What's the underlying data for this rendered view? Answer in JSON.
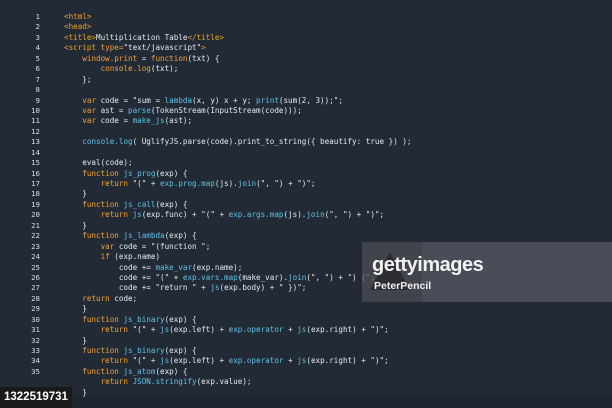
{
  "editor": {
    "line_numbers": [
      "1",
      "2",
      "3",
      "4",
      "5",
      "6",
      "7",
      "8",
      "9",
      "10",
      "11",
      "12",
      "13",
      "14",
      "15",
      "16",
      "17",
      "18",
      "19",
      "20",
      "21",
      "22",
      "23",
      "24",
      "25",
      "26",
      "27",
      "28",
      "29",
      "30",
      "31",
      "32",
      "33",
      "34",
      "35"
    ],
    "lines": [
      [
        {
          "t": "tag",
          "v": "<html>"
        }
      ],
      [
        {
          "t": "tag",
          "v": "<head>"
        }
      ],
      [
        {
          "t": "tag",
          "v": "<title>"
        },
        {
          "t": "plain",
          "v": "Multiplication Table"
        },
        {
          "t": "tag",
          "v": "</title>"
        }
      ],
      [
        {
          "t": "tag",
          "v": "<script "
        },
        {
          "t": "kw",
          "v": "type="
        },
        {
          "t": "plain",
          "v": "\"text/javascript\""
        },
        {
          "t": "tag",
          "v": ">"
        }
      ],
      [
        {
          "t": "plain",
          "v": "    "
        },
        {
          "t": "kw",
          "v": "window.print"
        },
        {
          "t": "plain",
          "v": " = "
        },
        {
          "t": "kw",
          "v": "function"
        },
        {
          "t": "plain",
          "v": "(txt) {"
        }
      ],
      [
        {
          "t": "plain",
          "v": "        "
        },
        {
          "t": "kw",
          "v": "console.log"
        },
        {
          "t": "plain",
          "v": "(txt);"
        }
      ],
      [
        {
          "t": "plain",
          "v": "    };"
        }
      ],
      [
        {
          "t": "plain",
          "v": ""
        }
      ],
      [
        {
          "t": "plain",
          "v": "    "
        },
        {
          "t": "kw",
          "v": "var"
        },
        {
          "t": "plain",
          "v": " code = \"sum = "
        },
        {
          "t": "fn",
          "v": "lambda"
        },
        {
          "t": "plain",
          "v": "(x, y) x + y; "
        },
        {
          "t": "fn",
          "v": "print"
        },
        {
          "t": "plain",
          "v": "(sum(2, 3));\";"
        }
      ],
      [
        {
          "t": "plain",
          "v": "    "
        },
        {
          "t": "kw",
          "v": "var"
        },
        {
          "t": "plain",
          "v": " ast = "
        },
        {
          "t": "fn",
          "v": "parse"
        },
        {
          "t": "plain",
          "v": "(TokenStream(InputStream(code)));"
        }
      ],
      [
        {
          "t": "plain",
          "v": "    "
        },
        {
          "t": "kw",
          "v": "var"
        },
        {
          "t": "plain",
          "v": " code = "
        },
        {
          "t": "fn",
          "v": "make_js"
        },
        {
          "t": "plain",
          "v": "(ast);"
        }
      ],
      [
        {
          "t": "plain",
          "v": ""
        }
      ],
      [
        {
          "t": "plain",
          "v": "    "
        },
        {
          "t": "fn",
          "v": "console.log"
        },
        {
          "t": "plain",
          "v": "( UglifyJS.parse(code).print_to_string({ beautify: true }) );"
        }
      ],
      [
        {
          "t": "plain",
          "v": ""
        }
      ],
      [
        {
          "t": "plain",
          "v": "    eval(code);"
        }
      ],
      [
        {
          "t": "plain",
          "v": "    "
        },
        {
          "t": "kw",
          "v": "function"
        },
        {
          "t": "plain",
          "v": " "
        },
        {
          "t": "fn",
          "v": "js_prog"
        },
        {
          "t": "plain",
          "v": "(exp) {"
        }
      ],
      [
        {
          "t": "plain",
          "v": "        "
        },
        {
          "t": "kw",
          "v": "return"
        },
        {
          "t": "plain",
          "v": " \"(\" + "
        },
        {
          "t": "fn",
          "v": "exp.prog.map"
        },
        {
          "t": "plain",
          "v": "(js)."
        },
        {
          "t": "fn",
          "v": "join"
        },
        {
          "t": "plain",
          "v": "(\", \") + \")\";"
        }
      ],
      [
        {
          "t": "plain",
          "v": "    }"
        }
      ],
      [
        {
          "t": "plain",
          "v": "    "
        },
        {
          "t": "kw",
          "v": "function"
        },
        {
          "t": "plain",
          "v": " "
        },
        {
          "t": "fn",
          "v": "js_call"
        },
        {
          "t": "plain",
          "v": "(exp) {"
        }
      ],
      [
        {
          "t": "plain",
          "v": "        "
        },
        {
          "t": "kw",
          "v": "return"
        },
        {
          "t": "plain",
          "v": " "
        },
        {
          "t": "fn",
          "v": "js"
        },
        {
          "t": "plain",
          "v": "(exp.func) + \"(\" + "
        },
        {
          "t": "fn",
          "v": "exp.args.map"
        },
        {
          "t": "plain",
          "v": "(js)."
        },
        {
          "t": "fn",
          "v": "join"
        },
        {
          "t": "plain",
          "v": "(\", \") + \")\";"
        }
      ],
      [
        {
          "t": "plain",
          "v": "    }"
        }
      ],
      [
        {
          "t": "plain",
          "v": "    "
        },
        {
          "t": "kw",
          "v": "function"
        },
        {
          "t": "plain",
          "v": " "
        },
        {
          "t": "fn",
          "v": "js_lambda"
        },
        {
          "t": "plain",
          "v": "(exp) {"
        }
      ],
      [
        {
          "t": "plain",
          "v": "        "
        },
        {
          "t": "kw",
          "v": "var"
        },
        {
          "t": "plain",
          "v": " code = \"(function \";"
        }
      ],
      [
        {
          "t": "plain",
          "v": "        "
        },
        {
          "t": "kw",
          "v": "if"
        },
        {
          "t": "plain",
          "v": " (exp.name)"
        }
      ],
      [
        {
          "t": "plain",
          "v": "            code += "
        },
        {
          "t": "fn",
          "v": "make_var"
        },
        {
          "t": "plain",
          "v": "(exp.name);"
        }
      ],
      [
        {
          "t": "plain",
          "v": "            code += \"(\" + "
        },
        {
          "t": "fn",
          "v": "exp.vars.map"
        },
        {
          "t": "plain",
          "v": "(make_var)."
        },
        {
          "t": "fn",
          "v": "join"
        },
        {
          "t": "plain",
          "v": "(\", \") + \") {\";"
        }
      ],
      [
        {
          "t": "plain",
          "v": "            code += \"return \" + "
        },
        {
          "t": "fn",
          "v": "js"
        },
        {
          "t": "plain",
          "v": "(exp.body) + \" })\";"
        }
      ],
      [
        {
          "t": "plain",
          "v": "    "
        },
        {
          "t": "kw",
          "v": "return"
        },
        {
          "t": "plain",
          "v": " code;"
        }
      ],
      [
        {
          "t": "plain",
          "v": "    }"
        }
      ],
      [
        {
          "t": "plain",
          "v": "    "
        },
        {
          "t": "kw",
          "v": "function"
        },
        {
          "t": "plain",
          "v": " "
        },
        {
          "t": "fn",
          "v": "js_binary"
        },
        {
          "t": "plain",
          "v": "(exp) {"
        }
      ],
      [
        {
          "t": "plain",
          "v": "        "
        },
        {
          "t": "kw",
          "v": "return"
        },
        {
          "t": "plain",
          "v": " \"(\" + "
        },
        {
          "t": "fn",
          "v": "js"
        },
        {
          "t": "plain",
          "v": "(exp.left) + "
        },
        {
          "t": "fn",
          "v": "exp.operator"
        },
        {
          "t": "plain",
          "v": " + "
        },
        {
          "t": "fn",
          "v": "js"
        },
        {
          "t": "plain",
          "v": "(exp.right) + \")\";"
        }
      ],
      [
        {
          "t": "plain",
          "v": "    }"
        }
      ],
      [
        {
          "t": "plain",
          "v": "    "
        },
        {
          "t": "kw",
          "v": "function"
        },
        {
          "t": "plain",
          "v": " "
        },
        {
          "t": "fn",
          "v": "js_binary"
        },
        {
          "t": "plain",
          "v": "(exp) {"
        }
      ],
      [
        {
          "t": "plain",
          "v": "        "
        },
        {
          "t": "kw",
          "v": "return"
        },
        {
          "t": "plain",
          "v": " \"(\" + "
        },
        {
          "t": "fn",
          "v": "js"
        },
        {
          "t": "plain",
          "v": "(exp.left) + "
        },
        {
          "t": "fn",
          "v": "exp.operator"
        },
        {
          "t": "plain",
          "v": " + "
        },
        {
          "t": "fn",
          "v": "js"
        },
        {
          "t": "plain",
          "v": "(exp.right) + \")\";"
        }
      ],
      [
        {
          "t": "plain",
          "v": "    "
        },
        {
          "t": "kw",
          "v": "function"
        },
        {
          "t": "plain",
          "v": " "
        },
        {
          "t": "fn",
          "v": "js_atom"
        },
        {
          "t": "plain",
          "v": "(exp) {"
        }
      ],
      [
        {
          "t": "plain",
          "v": "        "
        },
        {
          "t": "kw",
          "v": "return"
        },
        {
          "t": "plain",
          "v": " "
        },
        {
          "t": "fn",
          "v": "JSON.stringify"
        },
        {
          "t": "plain",
          "v": "(exp.value);"
        }
      ],
      [
        {
          "t": "plain",
          "v": "    }"
        }
      ]
    ]
  },
  "watermark": {
    "logo": "gettyimages",
    "credit": "PeterPencil"
  },
  "footer": {
    "image_id": "1322519731"
  },
  "colors": {
    "background": "#222a35",
    "tag": "#e8a22c",
    "keyword": "#f3a23a",
    "function": "#5ec3e8",
    "text": "#e6e9ef"
  }
}
